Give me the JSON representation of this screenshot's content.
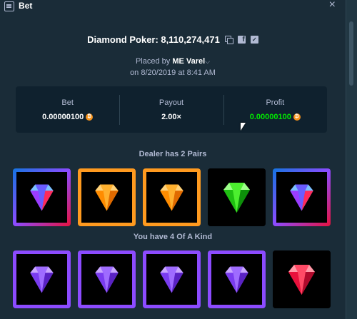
{
  "window": {
    "title": "Bet"
  },
  "game": {
    "title": "Diamond Poker: 8,110,274,471"
  },
  "placed": {
    "prefix": "Placed by",
    "user": "ME Varel",
    "date": "on 8/20/2019 at 8:41 AM"
  },
  "stats": {
    "bet": {
      "label": "Bet",
      "value": "0.00000100"
    },
    "payout": {
      "label": "Payout",
      "value": "2.00×"
    },
    "profit": {
      "label": "Profit",
      "value": "0.00000100"
    }
  },
  "dealer": {
    "label": "Dealer has 2 Pairs",
    "cards": [
      {
        "gem": "multi",
        "frame": "multi"
      },
      {
        "gem": "orange",
        "frame": "orange"
      },
      {
        "gem": "orange",
        "frame": "orange"
      },
      {
        "gem": "green",
        "frame": "none"
      },
      {
        "gem": "multi",
        "frame": "multi"
      }
    ]
  },
  "player": {
    "label": "You have 4 Of A Kind",
    "cards": [
      {
        "gem": "purple",
        "frame": "purple"
      },
      {
        "gem": "purple",
        "frame": "purple"
      },
      {
        "gem": "purple",
        "frame": "purple"
      },
      {
        "gem": "purple",
        "frame": "purple"
      },
      {
        "gem": "red",
        "frame": "none"
      }
    ]
  },
  "colors": {
    "background": "#1a2c38",
    "panel": "#0f212e",
    "profit_green": "#00e701",
    "btc_orange": "#f7931a",
    "frame_orange": "#ff9a1f",
    "frame_purple": "#8c4bff",
    "frame_blue": "#1475e1",
    "frame_red": "#e9113c"
  },
  "icons": {
    "copy": "copy-icon",
    "facebook": "facebook-icon",
    "twitter": "twitter-icon",
    "close": "close-icon",
    "currency": "bitcoin-icon",
    "dropdown": "chevron-down-icon"
  }
}
